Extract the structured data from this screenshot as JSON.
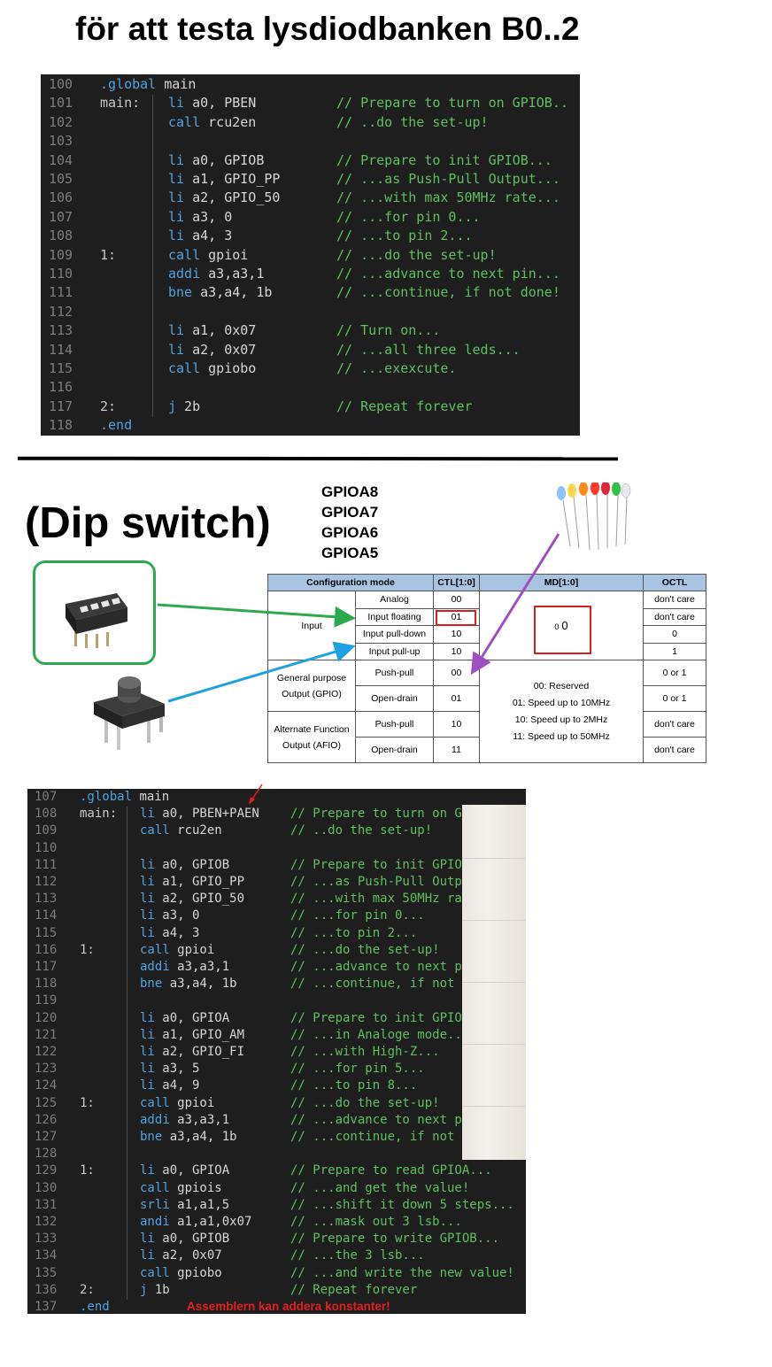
{
  "title": "för att testa lysdiodbanken B0..2",
  "code1": {
    "lines": [
      {
        "n": "100",
        "label": "",
        "ins": [
          {
            "t": ".global",
            "c": "kw"
          },
          {
            "t": " main",
            "c": "txt"
          }
        ],
        "comment": "",
        "lab_ins": true
      },
      {
        "n": "101",
        "label": "main:",
        "ins": [
          {
            "t": "li",
            "c": "kw"
          },
          {
            "t": " a0, PBEN",
            "c": "txt"
          }
        ],
        "comment": "// Prepare to turn on GPIOB.."
      },
      {
        "n": "102",
        "label": "",
        "ins": [
          {
            "t": "call",
            "c": "kw"
          },
          {
            "t": " rcu2en",
            "c": "txt"
          }
        ],
        "comment": "// ..do the set-up!"
      },
      {
        "n": "103",
        "label": "",
        "ins": [],
        "comment": ""
      },
      {
        "n": "104",
        "label": "",
        "ins": [
          {
            "t": "li",
            "c": "kw"
          },
          {
            "t": " a0, GPIOB",
            "c": "txt"
          }
        ],
        "comment": "// Prepare to init GPIOB..."
      },
      {
        "n": "105",
        "label": "",
        "ins": [
          {
            "t": "li",
            "c": "kw"
          },
          {
            "t": " a1, GPIO_PP",
            "c": "txt"
          }
        ],
        "comment": "// ...as Push-Pull Output..."
      },
      {
        "n": "106",
        "label": "",
        "ins": [
          {
            "t": "li",
            "c": "kw"
          },
          {
            "t": " a2, GPIO_50",
            "c": "txt"
          }
        ],
        "comment": "// ...with max 50MHz rate..."
      },
      {
        "n": "107",
        "label": "",
        "ins": [
          {
            "t": "li",
            "c": "kw"
          },
          {
            "t": " a3, 0",
            "c": "txt"
          }
        ],
        "comment": "// ...for pin 0..."
      },
      {
        "n": "108",
        "label": "",
        "ins": [
          {
            "t": "li",
            "c": "kw"
          },
          {
            "t": " a4, 3",
            "c": "txt"
          }
        ],
        "comment": "// ...to pin 2..."
      },
      {
        "n": "109",
        "label": "1:",
        "ins": [
          {
            "t": "call",
            "c": "kw"
          },
          {
            "t": " gpioi",
            "c": "txt"
          }
        ],
        "comment": "// ...do the set-up!"
      },
      {
        "n": "110",
        "label": "",
        "ins": [
          {
            "t": "addi",
            "c": "kw"
          },
          {
            "t": " a3,a3,1",
            "c": "txt"
          }
        ],
        "comment": "// ...advance to next pin..."
      },
      {
        "n": "111",
        "label": "",
        "ins": [
          {
            "t": "bne",
            "c": "kw"
          },
          {
            "t": " a3,a4, 1b",
            "c": "txt"
          }
        ],
        "comment": "// ...continue, if not done!"
      },
      {
        "n": "112",
        "label": "",
        "ins": [],
        "comment": ""
      },
      {
        "n": "113",
        "label": "",
        "ins": [
          {
            "t": "li",
            "c": "kw"
          },
          {
            "t": " a1, 0x07",
            "c": "txt"
          }
        ],
        "comment": "// Turn on..."
      },
      {
        "n": "114",
        "label": "",
        "ins": [
          {
            "t": "li",
            "c": "kw"
          },
          {
            "t": " a2, 0x07",
            "c": "txt"
          }
        ],
        "comment": "// ...all three leds..."
      },
      {
        "n": "115",
        "label": "",
        "ins": [
          {
            "t": "call",
            "c": "kw"
          },
          {
            "t": " gpiobo",
            "c": "txt"
          }
        ],
        "comment": "// ...exexcute."
      },
      {
        "n": "116",
        "label": "",
        "ins": [],
        "comment": ""
      },
      {
        "n": "117",
        "label": "2:",
        "ins": [
          {
            "t": "j",
            "c": "kw"
          },
          {
            "t": " 2b",
            "c": "txt"
          }
        ],
        "comment": "// Repeat forever"
      },
      {
        "n": "118",
        "label": "",
        "ins": [
          {
            "t": ".end",
            "c": "kw"
          }
        ],
        "comment": "",
        "lab_ins": true
      }
    ]
  },
  "dip_title": "(Dip switch)",
  "gpio_labels": [
    "GPIOA8",
    "GPIOA7",
    "GPIOA6",
    "GPIOA5"
  ],
  "config_table": {
    "headers": [
      "Configuration mode",
      "CTL[1:0]",
      "MD[1:0]",
      "OCTL"
    ],
    "input_label": "Input",
    "input_rows": [
      {
        "mode": "Analog",
        "ctl": "00",
        "octl": "don't care"
      },
      {
        "mode": "Input floating",
        "ctl": "01",
        "octl": "don't care"
      },
      {
        "mode": "Input pull-down",
        "ctl": "10",
        "octl": "0"
      },
      {
        "mode": "Input pull-up",
        "ctl": "10",
        "octl": "1"
      }
    ],
    "input_md_small": "0",
    "input_md": "0",
    "gpio_label_1": "General purpose",
    "gpio_label_2": "Output (GPIO)",
    "afio_label_1": "Alternate Function",
    "afio_label_2": "Output (AFIO)",
    "output_rows": [
      {
        "mode": "Push-pull",
        "ctl": "00",
        "octl": "0 or 1"
      },
      {
        "mode": "Open-drain",
        "ctl": "01",
        "octl": "0 or 1"
      },
      {
        "mode": "Push-pull",
        "ctl": "10",
        "octl": "don't care"
      },
      {
        "mode": "Open-drain",
        "ctl": "11",
        "octl": "don't care"
      }
    ],
    "md_lines": [
      "00: Reserved",
      "01: Speed up to 10MHz",
      "10: Speed up to 2MHz",
      "11: Speed up to 50MHz"
    ]
  },
  "code2": {
    "lines": [
      {
        "n": "107",
        "label": "",
        "ins": [
          {
            "t": ".global",
            "c": "kw"
          },
          {
            "t": " main",
            "c": "txt"
          }
        ],
        "comment": "",
        "lab_ins": true
      },
      {
        "n": "108",
        "label": "main:",
        "ins": [
          {
            "t": "li",
            "c": "kw"
          },
          {
            "t": " a0, PBEN+PAEN",
            "c": "txt"
          }
        ],
        "comment": "// Prepare to turn on G"
      },
      {
        "n": "109",
        "label": "",
        "ins": [
          {
            "t": "call",
            "c": "kw"
          },
          {
            "t": " rcu2en",
            "c": "txt"
          }
        ],
        "comment": "// ..do the set-up!"
      },
      {
        "n": "110",
        "label": "",
        "ins": [],
        "comment": ""
      },
      {
        "n": "111",
        "label": "",
        "ins": [
          {
            "t": "li",
            "c": "kw"
          },
          {
            "t": " a0, GPIOB",
            "c": "txt"
          }
        ],
        "comment": "// Prepare to init GPIO"
      },
      {
        "n": "112",
        "label": "",
        "ins": [
          {
            "t": "li",
            "c": "kw"
          },
          {
            "t": " a1, GPIO_PP",
            "c": "txt"
          }
        ],
        "comment": "// ...as Push-Pull Outp"
      },
      {
        "n": "113",
        "label": "",
        "ins": [
          {
            "t": "li",
            "c": "kw"
          },
          {
            "t": " a2, GPIO_50",
            "c": "txt"
          }
        ],
        "comment": "// ...with max 50MHz ra"
      },
      {
        "n": "114",
        "label": "",
        "ins": [
          {
            "t": "li",
            "c": "kw"
          },
          {
            "t": " a3, 0",
            "c": "txt"
          }
        ],
        "comment": "// ...for pin 0..."
      },
      {
        "n": "115",
        "label": "",
        "ins": [
          {
            "t": "li",
            "c": "kw"
          },
          {
            "t": " a4, 3",
            "c": "txt"
          }
        ],
        "comment": "// ...to pin 2..."
      },
      {
        "n": "116",
        "label": "1:",
        "ins": [
          {
            "t": "call",
            "c": "kw"
          },
          {
            "t": " gpioi",
            "c": "txt"
          }
        ],
        "comment": "// ...do the set-up!"
      },
      {
        "n": "117",
        "label": "",
        "ins": [
          {
            "t": "addi",
            "c": "kw"
          },
          {
            "t": " a3,a3,1",
            "c": "txt"
          }
        ],
        "comment": "// ...advance to next p"
      },
      {
        "n": "118",
        "label": "",
        "ins": [
          {
            "t": "bne",
            "c": "kw"
          },
          {
            "t": " a3,a4, 1b",
            "c": "txt"
          }
        ],
        "comment": "// ...continue, if not"
      },
      {
        "n": "119",
        "label": "",
        "ins": [],
        "comment": ""
      },
      {
        "n": "120",
        "label": "",
        "ins": [
          {
            "t": "li",
            "c": "kw"
          },
          {
            "t": " a0, GPIOA",
            "c": "txt"
          }
        ],
        "comment": "// Prepare to init GPIO"
      },
      {
        "n": "121",
        "label": "",
        "ins": [
          {
            "t": "li",
            "c": "kw"
          },
          {
            "t": " a1, GPIO_AM",
            "c": "txt"
          }
        ],
        "comment": "// ...in Analoge mode.."
      },
      {
        "n": "122",
        "label": "",
        "ins": [
          {
            "t": "li",
            "c": "kw"
          },
          {
            "t": " a2, GPIO_FI",
            "c": "txt"
          }
        ],
        "comment": "// ...with High-Z..."
      },
      {
        "n": "123",
        "label": "",
        "ins": [
          {
            "t": "li",
            "c": "kw"
          },
          {
            "t": " a3, 5",
            "c": "txt"
          }
        ],
        "comment": "// ...for pin 5..."
      },
      {
        "n": "124",
        "label": "",
        "ins": [
          {
            "t": "li",
            "c": "kw"
          },
          {
            "t": " a4, 9",
            "c": "txt"
          }
        ],
        "comment": "// ...to pin 8..."
      },
      {
        "n": "125",
        "label": "1:",
        "ins": [
          {
            "t": "call",
            "c": "kw"
          },
          {
            "t": " gpioi",
            "c": "txt"
          }
        ],
        "comment": "// ...do the set-up!"
      },
      {
        "n": "126",
        "label": "",
        "ins": [
          {
            "t": "addi",
            "c": "kw"
          },
          {
            "t": " a3,a3,1",
            "c": "txt"
          }
        ],
        "comment": "// ...advance to next p"
      },
      {
        "n": "127",
        "label": "",
        "ins": [
          {
            "t": "bne",
            "c": "kw"
          },
          {
            "t": " a3,a4, 1b",
            "c": "txt"
          }
        ],
        "comment": "// ...continue, if not"
      },
      {
        "n": "128",
        "label": "",
        "ins": [],
        "comment": ""
      },
      {
        "n": "129",
        "label": "1:",
        "ins": [
          {
            "t": "li",
            "c": "kw"
          },
          {
            "t": " a0, GPIOA",
            "c": "txt"
          }
        ],
        "comment": "// Prepare to read GPIOA..."
      },
      {
        "n": "130",
        "label": "",
        "ins": [
          {
            "t": "call",
            "c": "kw"
          },
          {
            "t": " gpiois",
            "c": "txt"
          }
        ],
        "comment": "// ...and get the value!"
      },
      {
        "n": "131",
        "label": "",
        "ins": [
          {
            "t": "srli",
            "c": "kw"
          },
          {
            "t": " a1,a1,5",
            "c": "txt"
          }
        ],
        "comment": "// ...shift it down 5 steps..."
      },
      {
        "n": "132",
        "label": "",
        "ins": [
          {
            "t": "andi",
            "c": "kw"
          },
          {
            "t": " a1,a1,0x07",
            "c": "txt"
          }
        ],
        "comment": "// ...mask out 3 lsb..."
      },
      {
        "n": "133",
        "label": "",
        "ins": [
          {
            "t": "li",
            "c": "kw"
          },
          {
            "t": " a0, GPIOB",
            "c": "txt"
          }
        ],
        "comment": "// Prepare to write GPIOB..."
      },
      {
        "n": "134",
        "label": "",
        "ins": [
          {
            "t": "li",
            "c": "kw"
          },
          {
            "t": " a2, 0x07",
            "c": "txt"
          }
        ],
        "comment": "// ...the 3 lsb..."
      },
      {
        "n": "135",
        "label": "",
        "ins": [
          {
            "t": "call",
            "c": "kw"
          },
          {
            "t": " gpiobo",
            "c": "txt"
          }
        ],
        "comment": "// ...and write the new value!"
      },
      {
        "n": "136",
        "label": "2:",
        "ins": [
          {
            "t": "j",
            "c": "kw"
          },
          {
            "t": " 1b",
            "c": "txt"
          }
        ],
        "comment": "// Repeat forever"
      },
      {
        "n": "137",
        "label": "",
        "ins": [
          {
            "t": ".end",
            "c": "kw"
          }
        ],
        "comment": "",
        "lab_ins": true
      }
    ]
  },
  "note": "Assemblern kan addera konstanter!",
  "colors": {
    "code_bg": "#1e1e1e",
    "keyword": "#4ea3e0",
    "comment": "#5fbf5f",
    "green_arrow": "#2eaa4e",
    "blue_arrow": "#1fa0e0",
    "purple_arrow": "#a04ec0",
    "red": "#e02020"
  }
}
